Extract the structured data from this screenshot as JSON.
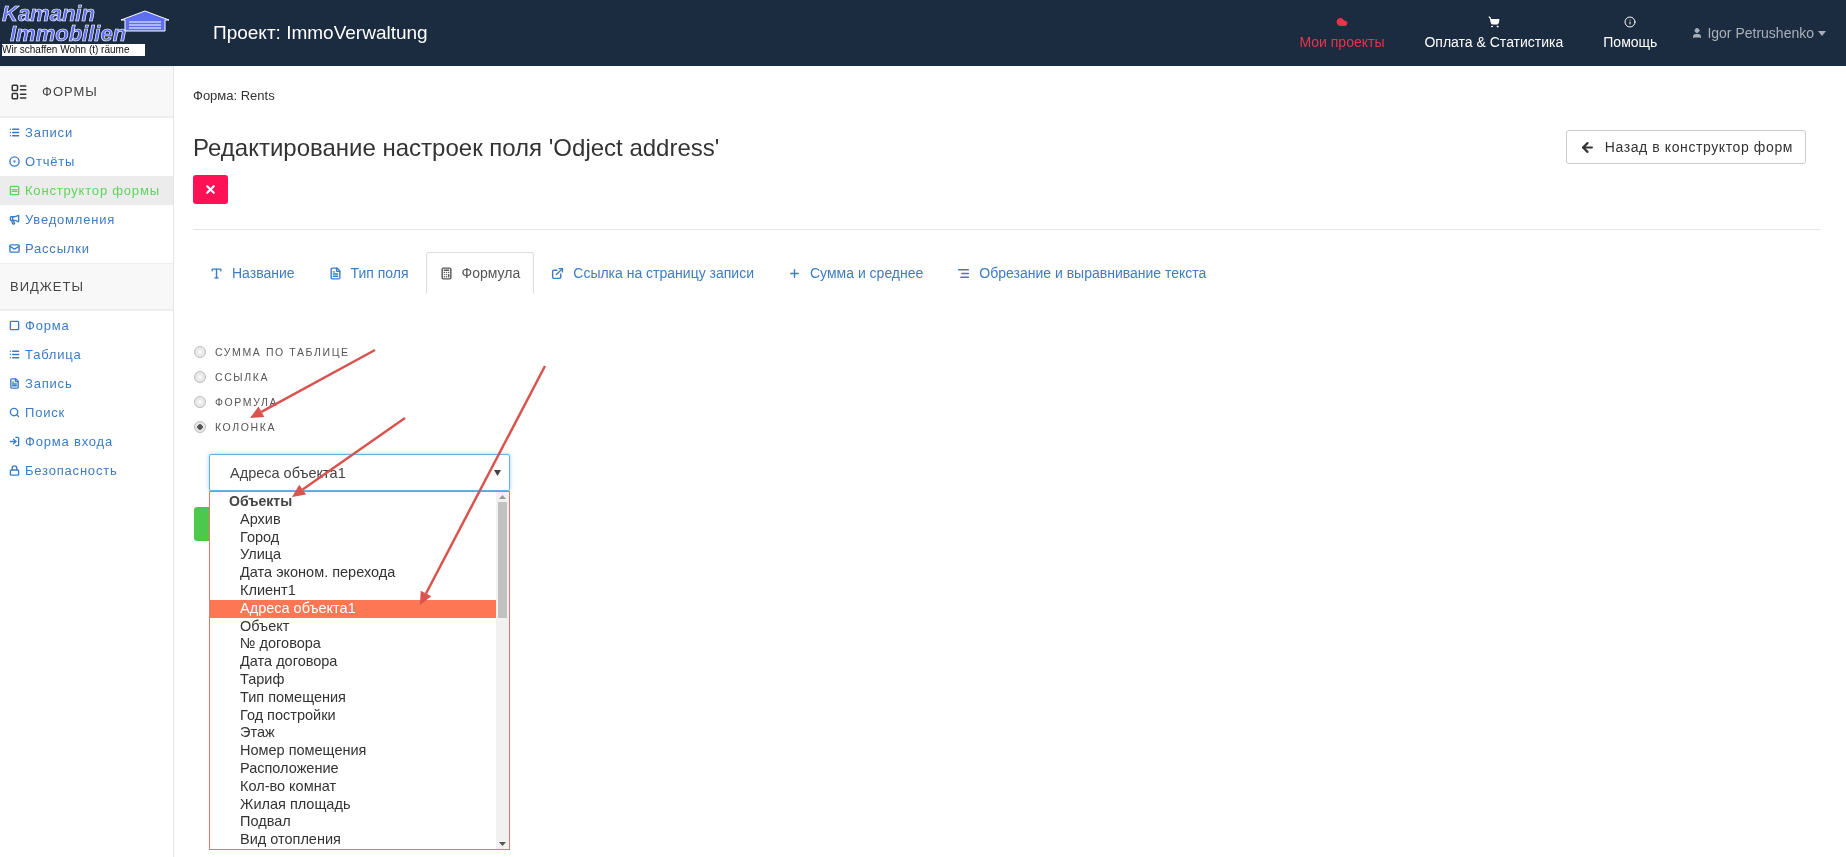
{
  "logo": {
    "name": "Kamanin",
    "name_2": "Immobilien",
    "tagline": "Wir schaffen Wohn (t) räume"
  },
  "project_title": "Проект: ImmoVerwaltung",
  "nav": [
    {
      "label": "Мои проекты",
      "selected": true
    },
    {
      "label": "Оплата & Статистика",
      "selected": false
    },
    {
      "label": "Помощь",
      "selected": false
    }
  ],
  "user": "Igor Petrushenko",
  "sidebar": {
    "sections": [
      {
        "title": "ФОРМЫ",
        "items": [
          {
            "label": "Записи",
            "selected": false
          },
          {
            "label": "Отчёты",
            "selected": false
          },
          {
            "label": "Конструктор формы",
            "selected": true
          },
          {
            "label": "Уведомления",
            "selected": false
          },
          {
            "label": "Рассылки",
            "selected": false
          }
        ]
      },
      {
        "title": "ВИДЖЕТЫ",
        "items": [
          {
            "label": "Форма",
            "selected": false
          },
          {
            "label": "Таблица",
            "selected": false
          },
          {
            "label": "Запись",
            "selected": false
          },
          {
            "label": "Поиск",
            "selected": false
          },
          {
            "label": "Форма входа",
            "selected": false
          },
          {
            "label": "Безопасность",
            "selected": false
          }
        ]
      }
    ]
  },
  "breadcrumb": "Форма: Rents",
  "heading": "Редактирование настроек поля 'Odject address'",
  "back_button": "Назад в конструктор форм",
  "tabs": [
    {
      "label": "Название",
      "selected": false
    },
    {
      "label": "Тип поля",
      "selected": false
    },
    {
      "label": "Формула",
      "selected": true
    },
    {
      "label": "Ссылка на страницу записи",
      "selected": false
    },
    {
      "label": "Сумма и среднее",
      "selected": false
    },
    {
      "label": "Обрезание и выравнивание текста",
      "selected": false
    }
  ],
  "radios": [
    {
      "label": "СУММА ПО ТАБЛИЦЕ",
      "selected": false
    },
    {
      "label": "ССЫЛКА",
      "selected": false
    },
    {
      "label": "ФОРМУЛА",
      "selected": false
    },
    {
      "label": "КОЛОНКА",
      "selected": true
    }
  ],
  "select": {
    "value": "Адреса объекта1",
    "group": "Объекты",
    "options": [
      {
        "label": "Архив",
        "selected": false
      },
      {
        "label": "Город",
        "selected": false
      },
      {
        "label": "Улица",
        "selected": false
      },
      {
        "label": "Дата эконом. перехода",
        "selected": false
      },
      {
        "label": "Клиент1",
        "selected": false
      },
      {
        "label": "Адреса объекта1",
        "selected": true
      },
      {
        "label": "Объект",
        "selected": false
      },
      {
        "label": "№ договора",
        "selected": false
      },
      {
        "label": "Дата договора",
        "selected": false
      },
      {
        "label": "Тариф",
        "selected": false
      },
      {
        "label": "Тип помещения",
        "selected": false
      },
      {
        "label": "Год постройки",
        "selected": false
      },
      {
        "label": "Этаж",
        "selected": false
      },
      {
        "label": "Номер помещения",
        "selected": false
      },
      {
        "label": "Расположение",
        "selected": false
      },
      {
        "label": "Кол-во комнат",
        "selected": false
      },
      {
        "label": "Жилая площадь",
        "selected": false
      },
      {
        "label": "Подвал",
        "selected": false
      },
      {
        "label": "Вид отопления",
        "selected": false
      }
    ]
  }
}
